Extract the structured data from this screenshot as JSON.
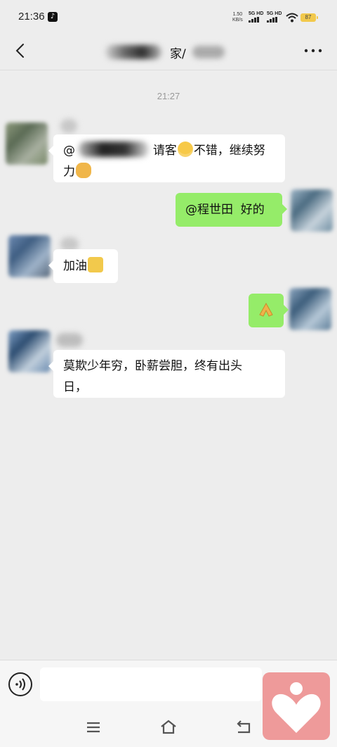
{
  "status_bar": {
    "time": "21:36",
    "net_speed_value": "1.50",
    "net_speed_unit": "KB/s",
    "sim1_label": "5G HD",
    "sim2_label": "5G HD",
    "battery_level": "87"
  },
  "header": {
    "title_visible_char": "家/",
    "back_icon": "chevron-left-icon",
    "more_icon": "ellipsis-icon"
  },
  "chat": {
    "timestamp": "21:27",
    "messages": [
      {
        "side": "left",
        "text_parts": [
          "@",
          "请客",
          "不错，继续努",
          "力"
        ],
        "emojis": [
          "grinning-face",
          "handshake"
        ]
      },
      {
        "side": "right",
        "text": "@程世田  好的"
      },
      {
        "side": "left",
        "text": "加油",
        "emojis": [
          "thumbs-up"
        ]
      },
      {
        "side": "right",
        "emojis": [
          "folded-hands"
        ]
      },
      {
        "side": "left",
        "text_line1": "莫欺少年穷，卧薪尝胆，终有出头",
        "text_line2": "日，"
      }
    ]
  },
  "input_bar": {
    "voice_icon": "voice-icon",
    "input_value": ""
  },
  "nav_bar": {
    "menu_icon": "menu-icon",
    "home_icon": "home-icon",
    "back_icon": "back-arrow-icon"
  },
  "colors": {
    "background": "#ededed",
    "self_bubble": "#95ec69",
    "other_bubble": "#ffffff",
    "overlay": "#ee9a9a"
  }
}
